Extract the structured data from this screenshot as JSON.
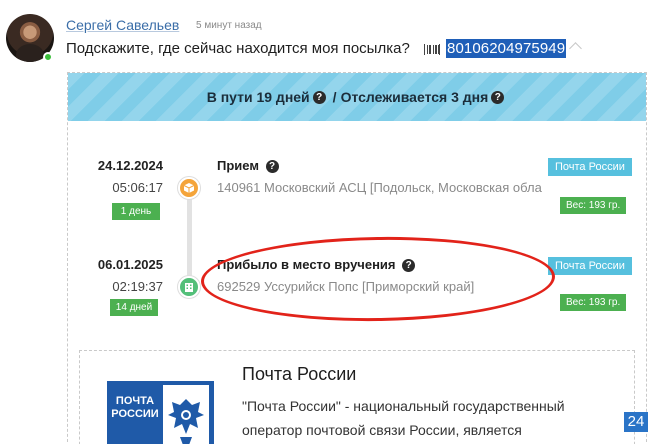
{
  "comment": {
    "author": "Сергей Савельев",
    "time_ago": "5 минут назад",
    "question": "Подскажите, где сейчас находится моя посылка?",
    "track_number": "80106204975949"
  },
  "tracking": {
    "banner_days_in_transit": "В пути 19 дней",
    "banner_separator": "/",
    "banner_tracked_days": "Отслеживается 3 дня",
    "events": [
      {
        "date": "24.12.2024",
        "time": "05:06:17",
        "days": "1 день",
        "title": "Прием",
        "place": "140961 Московский АСЦ [Подольск, Московская обла",
        "carrier": "Почта России",
        "weight": "Вес: 193 гр."
      },
      {
        "date": "06.01.2025",
        "time": "02:19:37",
        "days": "14 дней",
        "title": "Прибыло в место вручения",
        "place": "692529 Уссурийск Попс [Приморский край]",
        "carrier": "Почта России",
        "weight": "Вес: 193 гр."
      }
    ]
  },
  "carrier_info": {
    "logo_text": "ПОЧТА РОССИИ",
    "name": "Почта России",
    "description": "\"Почта России\" - национальный государственный оператор почтовой связи России, является"
  },
  "page_counter": "24",
  "colors": {
    "banner": "#7fcde8",
    "badge_green": "#4cb050",
    "badge_blue": "#56c0de",
    "highlight": "#1f5fb8",
    "annotation_red": "#e2231a"
  }
}
